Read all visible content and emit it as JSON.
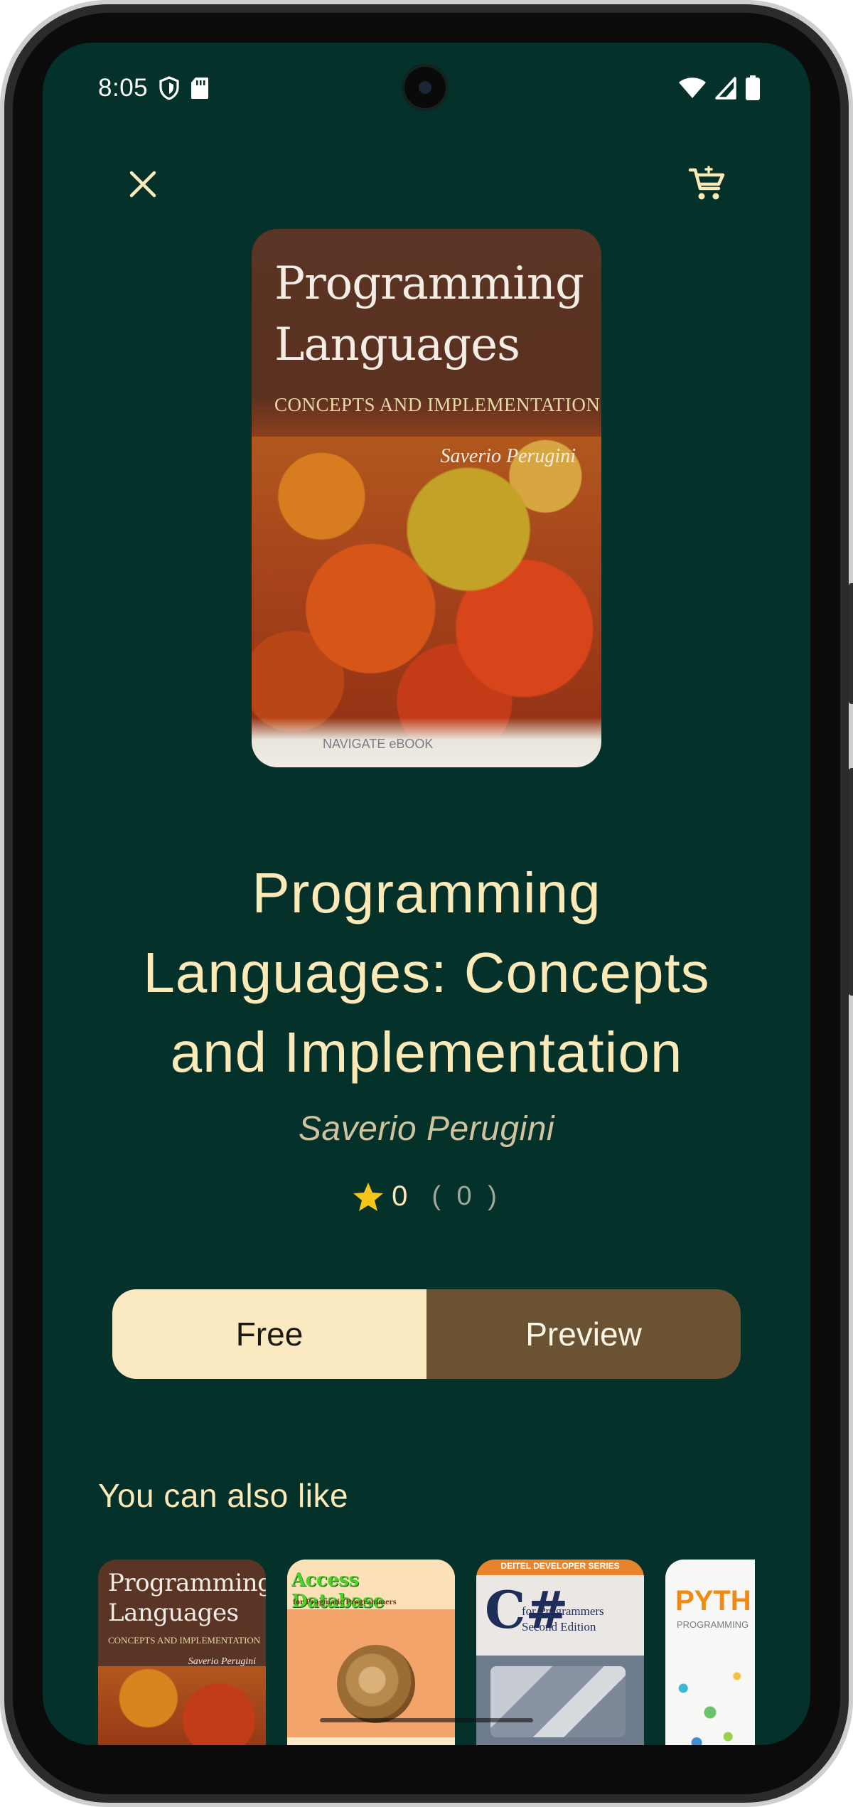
{
  "status_bar": {
    "time": "8:05",
    "left_icons": [
      "shield-icon",
      "sd-card-icon"
    ],
    "right_icons": [
      "wifi-icon",
      "signal-icon",
      "battery-icon"
    ]
  },
  "top_bar": {
    "close_icon": "close-icon",
    "cart_icon": "cart-icon"
  },
  "cover": {
    "title_line1": "Programming",
    "title_line2": "Languages",
    "subtitle": "CONCEPTS AND IMPLEMENTATION",
    "author": "Saverio Perugini",
    "badge": "NAVIGATE eBOOK"
  },
  "book": {
    "title": "Programming Languages: Concepts and Implementation",
    "author": "Saverio Perugini",
    "rating": "0",
    "rating_count": "( 0 )"
  },
  "actions": {
    "free_label": "Free",
    "preview_label": "Preview"
  },
  "recommendations": {
    "title": "You can also like",
    "items": [
      {
        "title_line1": "Programming",
        "title_line2": "Languages",
        "subtitle": "CONCEPTS AND IMPLEMENTATION",
        "author": "Saverio Perugini"
      },
      {
        "title": "Access Database",
        "subtitle": "for Pragmatic Programmers"
      },
      {
        "header": "DEITEL DEVELOPER SERIES",
        "letter": "C#",
        "subtitle_line1": "for Programmers",
        "subtitle_line2": "Second Edition"
      },
      {
        "title": "PYTH",
        "subtitle": "PROGRAMMING"
      }
    ]
  },
  "colors": {
    "background": "#05312b",
    "accent": "#fbe9b8",
    "free_button": "#fbe9c2",
    "preview_button": "#6b5232",
    "star": "#f5c518"
  }
}
